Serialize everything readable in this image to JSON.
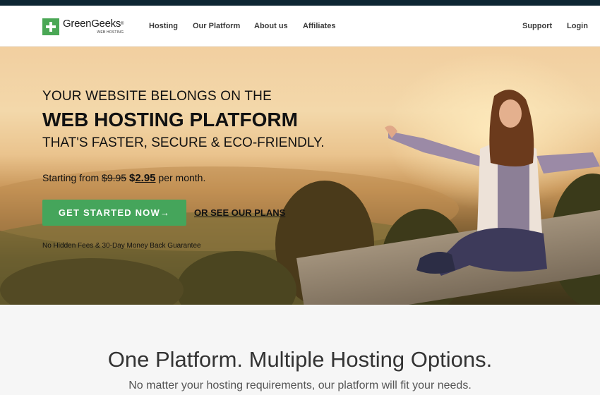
{
  "brand": {
    "name": "GreenGeeks",
    "registered": "®",
    "tagline": "WEB HOSTING",
    "accent_color": "#45a55b"
  },
  "nav": {
    "left_items": [
      {
        "label": "Hosting"
      },
      {
        "label": "Our Platform"
      },
      {
        "label": "About us"
      },
      {
        "label": "Affiliates"
      }
    ],
    "right_items": [
      {
        "label": "Support"
      },
      {
        "label": "Login"
      }
    ]
  },
  "hero": {
    "line1": "YOUR WEBSITE BELONGS ON THE",
    "line2": "WEB HOSTING PLATFORM",
    "line3": "THAT'S FASTER, SECURE & ECO-FRIENDLY.",
    "price_prefix": "Starting from",
    "old_price": "$9.95",
    "currency": "$",
    "new_price": "2.95",
    "price_suffix": "per month.",
    "cta_label": "GET STARTED NOW",
    "cta_icon": "arrow-right-icon",
    "cta_arrow": "→",
    "plans_link": "OR SEE OUR PLANS",
    "guarantee": "No Hidden Fees & 30-Day Money Back Guarantee",
    "image_description": "Woman with arms outstretched sitting on a stone wall overlooking sunset hills"
  },
  "section": {
    "title": "One Platform. Multiple Hosting Options.",
    "subtitle": "No matter your hosting requirements, our platform will fit your needs."
  }
}
